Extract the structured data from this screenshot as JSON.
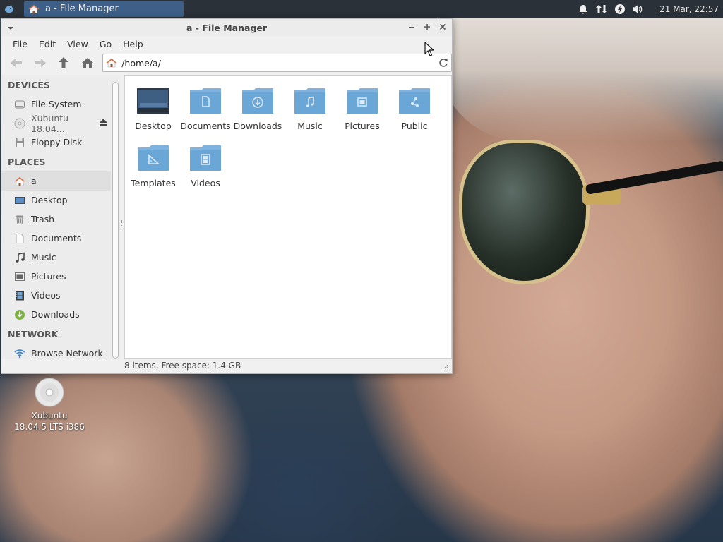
{
  "top_panel": {
    "task_title": "a - File Manager",
    "clock": "21 Mar, 22:57"
  },
  "window": {
    "title": "a - File Manager",
    "menu": [
      "File",
      "Edit",
      "View",
      "Go",
      "Help"
    ],
    "location_path": "/home/a/",
    "sidebar": {
      "devices_header": "DEVICES",
      "devices": [
        {
          "label": "File System",
          "icon": "drive-harddisk-icon"
        },
        {
          "label": "Xubuntu 18.04...",
          "icon": "optical-disc-icon"
        },
        {
          "label": "Floppy Disk",
          "icon": "floppy-icon"
        }
      ],
      "places_header": "PLACES",
      "places": [
        {
          "label": "a",
          "icon": "home-icon"
        },
        {
          "label": "Desktop",
          "icon": "desktop-icon"
        },
        {
          "label": "Trash",
          "icon": "trash-icon"
        },
        {
          "label": "Documents",
          "icon": "document-icon"
        },
        {
          "label": "Music",
          "icon": "music-icon"
        },
        {
          "label": "Pictures",
          "icon": "pictures-icon"
        },
        {
          "label": "Videos",
          "icon": "videos-icon"
        },
        {
          "label": "Downloads",
          "icon": "downloads-icon"
        }
      ],
      "network_header": "NETWORK",
      "network": [
        {
          "label": "Browse Network",
          "icon": "wifi-icon"
        }
      ]
    },
    "files": [
      {
        "name": "Desktop",
        "icon": "desktop-folder-icon"
      },
      {
        "name": "Documents",
        "icon": "documents-folder-icon"
      },
      {
        "name": "Downloads",
        "icon": "downloads-folder-icon"
      },
      {
        "name": "Music",
        "icon": "music-folder-icon"
      },
      {
        "name": "Pictures",
        "icon": "pictures-folder-icon"
      },
      {
        "name": "Public",
        "icon": "public-folder-icon"
      },
      {
        "name": "Templates",
        "icon": "templates-folder-icon"
      },
      {
        "name": "Videos",
        "icon": "videos-folder-icon"
      }
    ],
    "status": "8 items, Free space: 1.4 GB"
  },
  "desktop_icon": {
    "line1": "Xubuntu",
    "line2": "18.04.5 LTS i386"
  },
  "colors": {
    "panel_bg": "#2b3138",
    "task_active": "#3d5f88",
    "folder_blue": "#6aa6d6",
    "folder_dark": "#4f8cc0"
  }
}
